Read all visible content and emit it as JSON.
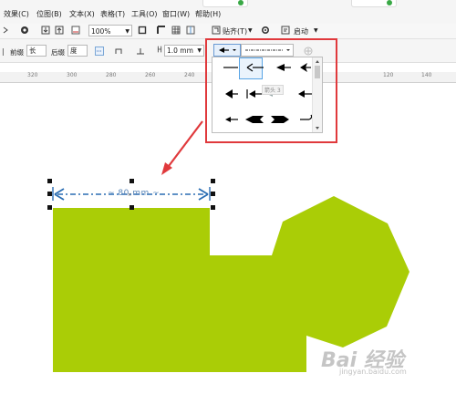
{
  "menu": {
    "items": [
      "效果(C)",
      "位图(B)",
      "文本(X)",
      "表格(T)",
      "工具(O)",
      "窗口(W)",
      "帮助(H)"
    ]
  },
  "toolbar": {
    "zoom_value": "100%",
    "snap_label": "贴齐(T)",
    "launch_label": "启动"
  },
  "property_bar": {
    "front_label": "前缀",
    "front_value": "长",
    "back_label": "后缀",
    "back_value": "度",
    "outline_width": "1.0 mm"
  },
  "ruler": {
    "ticks": [
      "320",
      "300",
      "280",
      "260",
      "240",
      "120",
      "140"
    ]
  },
  "dropdown": {
    "tooltip": "箭头 3"
  },
  "canvas": {
    "dimension_text": "~ 80 mm ~",
    "shape_color": "#aacd06"
  },
  "watermark": {
    "brand": "Bai 经验",
    "url": "jingyan.baidu.com"
  },
  "colors": {
    "annotation_red": "#e0393c",
    "dimension_blue": "#2a6db3"
  }
}
